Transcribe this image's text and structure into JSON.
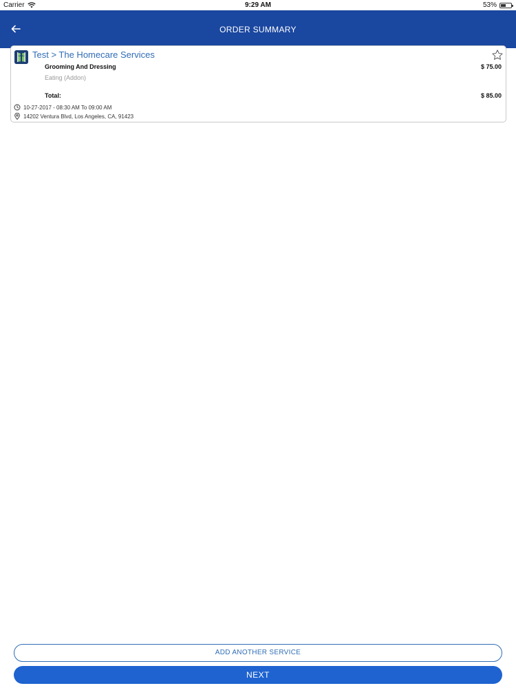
{
  "status_bar": {
    "carrier": "Carrier",
    "time": "9:29 AM",
    "battery": "53%",
    "battery_level": 0.53
  },
  "nav": {
    "title": "ORDER SUMMARY",
    "back_icon": "back-arrow-icon"
  },
  "order": {
    "provider_title": "Test > The Homecare Services",
    "items": [
      {
        "name": "Grooming And Dressing",
        "price": "$ 75.00"
      },
      {
        "name": "Eating (Addon)"
      }
    ],
    "total_label": "Total:",
    "total_value": "$ 85.00",
    "schedule": "10-27-2017 - 08:30 AM To 09:00 AM",
    "address": "14202 Ventura Blvd, Los Angeles, CA, 91423"
  },
  "actions": {
    "add_service_label": "ADD ANOTHER SERVICE",
    "next_label": "NEXT"
  },
  "colors": {
    "nav_bg": "#1a47a0",
    "accent": "#2f6cb5",
    "primary_button": "#1e63d0"
  }
}
